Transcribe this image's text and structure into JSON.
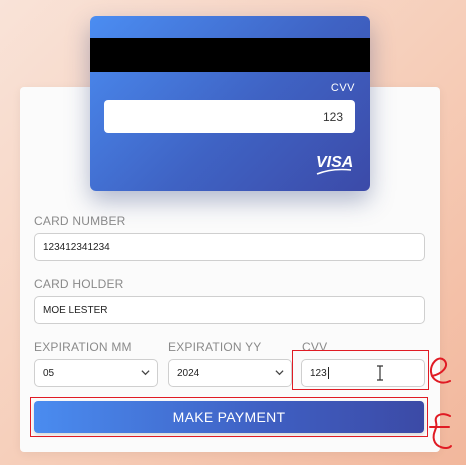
{
  "card": {
    "cvv_label": "CVV",
    "cvv_value": "123",
    "brand": "VISA"
  },
  "form": {
    "card_number": {
      "label": "CARD NUMBER",
      "value": "123412341234"
    },
    "card_holder": {
      "label": "CARD HOLDER",
      "value": "MOE LESTER"
    },
    "expiration_mm": {
      "label": "EXPIRATION MM",
      "value": "05"
    },
    "expiration_yy": {
      "label": "EXPIRATION YY",
      "value": "2024"
    },
    "cvv": {
      "label": "CVV",
      "value": "123"
    },
    "submit_label": "MAKE PAYMENT"
  },
  "annotations": {
    "highlight_color": "#e01b24",
    "cvv_mark": "e",
    "button_mark": "f"
  },
  "icons": {
    "select_arrow": "chevron-down-icon",
    "text_cursor": "text-cursor-icon",
    "brand_logo": "visa-logo-icon"
  }
}
